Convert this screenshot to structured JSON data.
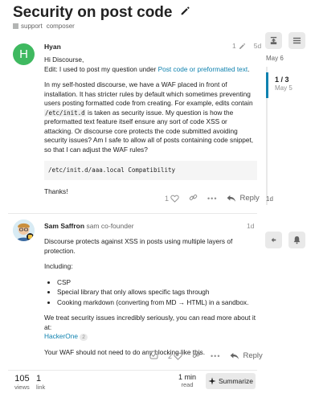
{
  "topic": {
    "title": "Security on post code",
    "category": "support",
    "tag": "composer"
  },
  "timeline": {
    "date_top": "May 6",
    "count": "1 / 3",
    "current_date": "May 5",
    "date_bottom": "1d"
  },
  "post1": {
    "avatar_letter": "H",
    "username": "Hyan",
    "edit_count": "1",
    "age": "5d",
    "greeting": "Hi Discourse,",
    "edit_prefix": "Edit: I used to post my question under ",
    "edit_link": "Post code or preformatted text",
    "edit_suffix": ".",
    "para_part1": "In my self-hosted discourse, we have a WAF placed in front of installation. It has stricter rules by default which sometimes preventing users posting formatted code from creating. For example, edits contain ",
    "para_code": "/etc/init.d",
    "para_part2": " is taken as security issue. My question is how the preformatted text feature itself ensure any sort of code XSS or attacking. Or discourse core protects the code submitted avoiding security issues? Am I safe to allow all of posts containing code snippet, so that I can adjust the WAF rules?",
    "code_block": "/etc/init.d/aaa.local Compatibility",
    "thanks": "Thanks!",
    "likes": "1",
    "reply_label": "Reply"
  },
  "post2": {
    "username": "Sam Saffron",
    "handle": "sam",
    "user_title": "co-founder",
    "age": "1d",
    "intro": "Discourse protects against XSS in posts using multiple layers of protection.",
    "including": "Including:",
    "bullets": [
      "CSP",
      "Special library that only allows specific tags through",
      "Cooking markdown (converting from MD → HTML) in a sandbox."
    ],
    "serious": "We treat security issues incredibly seriously, you can read more about it at:",
    "link": "HackerOne",
    "link_count": "2",
    "closing": "Your WAF should not need to do any blocking like this.",
    "likes": "2",
    "reply_label": "Reply"
  },
  "footer": {
    "views_num": "105",
    "views_label": "views",
    "links_num": "1",
    "links_label": "link",
    "read_num": "1 min",
    "read_label": "read",
    "summarize_label": "Summarize"
  },
  "colors": {
    "accent": "#0f82af",
    "avatar_h": "#3fb960",
    "muted": "#919191"
  }
}
